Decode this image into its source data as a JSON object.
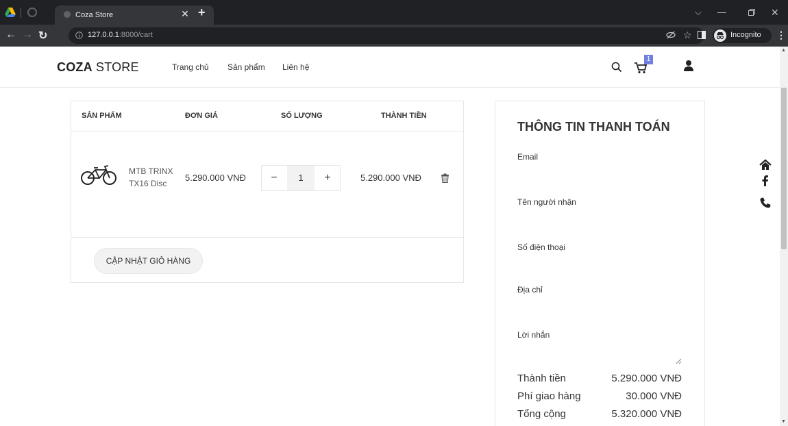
{
  "browser": {
    "tab_title": "Coza Store",
    "url_host": "127.0.0.1",
    "url_rest": ":8000/cart",
    "incognito_label": "Incognito"
  },
  "site": {
    "logo_bold": "COZA",
    "logo_rest": " STORE",
    "menu": [
      "Trang chủ",
      "Sản phẩm",
      "Liên hệ"
    ],
    "cart_count": "1"
  },
  "cart": {
    "headers": [
      "SẢN PHẨM",
      "ĐƠN GIÁ",
      "SỐ LƯỢNG",
      "THÀNH TIỀN"
    ],
    "items": [
      {
        "name": "MTB TRINX TX16 Disc",
        "price": "5.290.000 VNĐ",
        "quantity": "1",
        "total": "5.290.000 VNĐ"
      }
    ],
    "decrease_label": "−",
    "increase_label": "+",
    "update_button": "CẬP NHẬT GIỎ HÀNG"
  },
  "checkout": {
    "title": "THÔNG TIN THANH TOÁN",
    "fields": [
      "Email",
      "Tên người nhận",
      "Số điện thoại",
      "Địa chỉ",
      "Lời nhắn"
    ],
    "summary": [
      {
        "label": "Thành tiền",
        "value": "5.290.000 VNĐ"
      },
      {
        "label": "Phí giao hàng",
        "value": "30.000 VNĐ"
      },
      {
        "label": "Tổng cộng",
        "value": "5.320.000 VNĐ"
      }
    ]
  },
  "colors": {
    "cart_badge": "#717fe0",
    "text": "#333333",
    "border": "#e6e6e6"
  }
}
